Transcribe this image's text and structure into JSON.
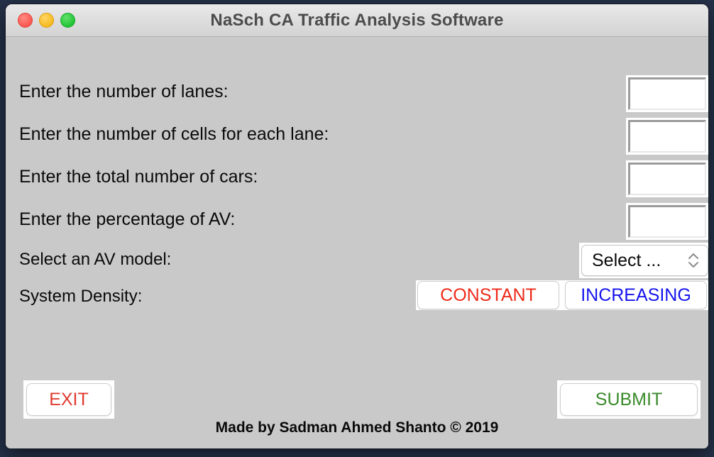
{
  "desktop": {
    "background_color": "#26324a"
  },
  "window": {
    "title": "NaSch CA Traffic Analysis Software",
    "controls": [
      {
        "name": "close",
        "label": "close-button"
      },
      {
        "name": "minimize",
        "label": "minimize-button"
      },
      {
        "name": "maximize",
        "label": "maximize-button"
      }
    ]
  },
  "form": {
    "labels": {
      "lanes": "Enter the number of lanes:",
      "cells": "Enter the number of cells for each lane:",
      "cars": "Enter the total number of cars:",
      "av_percentage": "Enter the percentage of AV:",
      "av_model": "Select an AV model:",
      "system_density": "System Density:"
    },
    "inputs": {
      "lanes": {
        "value": "",
        "placeholder": ""
      },
      "cells": {
        "value": "",
        "placeholder": ""
      },
      "cars": {
        "value": "",
        "placeholder": ""
      },
      "av_percentage": {
        "value": "",
        "placeholder": ""
      }
    },
    "dropdown": {
      "selected": "Select ...",
      "up_arrow": "⌃",
      "down_arrow": "⌄"
    },
    "density_buttons": [
      {
        "label": "CONSTANT",
        "color": "#ee2a19"
      },
      {
        "label": "INCREASING",
        "color": "#1414ee"
      }
    ]
  },
  "actions": {
    "exit": {
      "label": "EXIT",
      "color": "#e03b31"
    },
    "submit": {
      "label": "SUBMIT",
      "color": "#3a8a2b"
    }
  },
  "footer": {
    "credit": "Made by Sadman Ahmed Shanto © 2019"
  }
}
